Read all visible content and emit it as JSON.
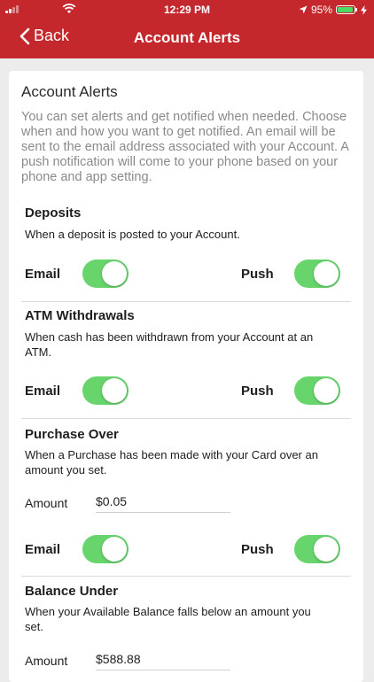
{
  "status_bar": {
    "time": "12:29 PM",
    "battery": "95%",
    "battery_level": 0.95
  },
  "nav": {
    "back_label": "Back",
    "title": "Account Alerts"
  },
  "card": {
    "heading": "Account Alerts",
    "intro": "You can set alerts and get notified when needed. Choose when and how you want to get notified. An email will be sent to the email address associated with your Account. A push notification will come to your phone based on your phone and app setting."
  },
  "sections": [
    {
      "title": "Deposits",
      "desc": "When a deposit is posted to your Account.",
      "email_label": "Email",
      "push_label": "Push",
      "email_on": true,
      "push_on": true
    },
    {
      "title": "ATM Withdrawals",
      "desc": "When cash has been withdrawn from your Account at an ATM.",
      "email_label": "Email",
      "push_label": "Push",
      "email_on": true,
      "push_on": true
    },
    {
      "title": "Purchase Over",
      "desc": "When a Purchase has been made with your Card over an amount you set.",
      "amount_label": "Amount",
      "amount_value": "$0.05",
      "email_label": "Email",
      "push_label": "Push",
      "email_on": true,
      "push_on": true
    },
    {
      "title": "Balance Under",
      "desc": "When your Available Balance falls below an amount you set.",
      "amount_label": "Amount",
      "amount_value": "$588.88"
    }
  ],
  "colors": {
    "nav_red": "#c4272c",
    "toggle_on": "#67d56c",
    "battery_green": "#4cd964"
  }
}
